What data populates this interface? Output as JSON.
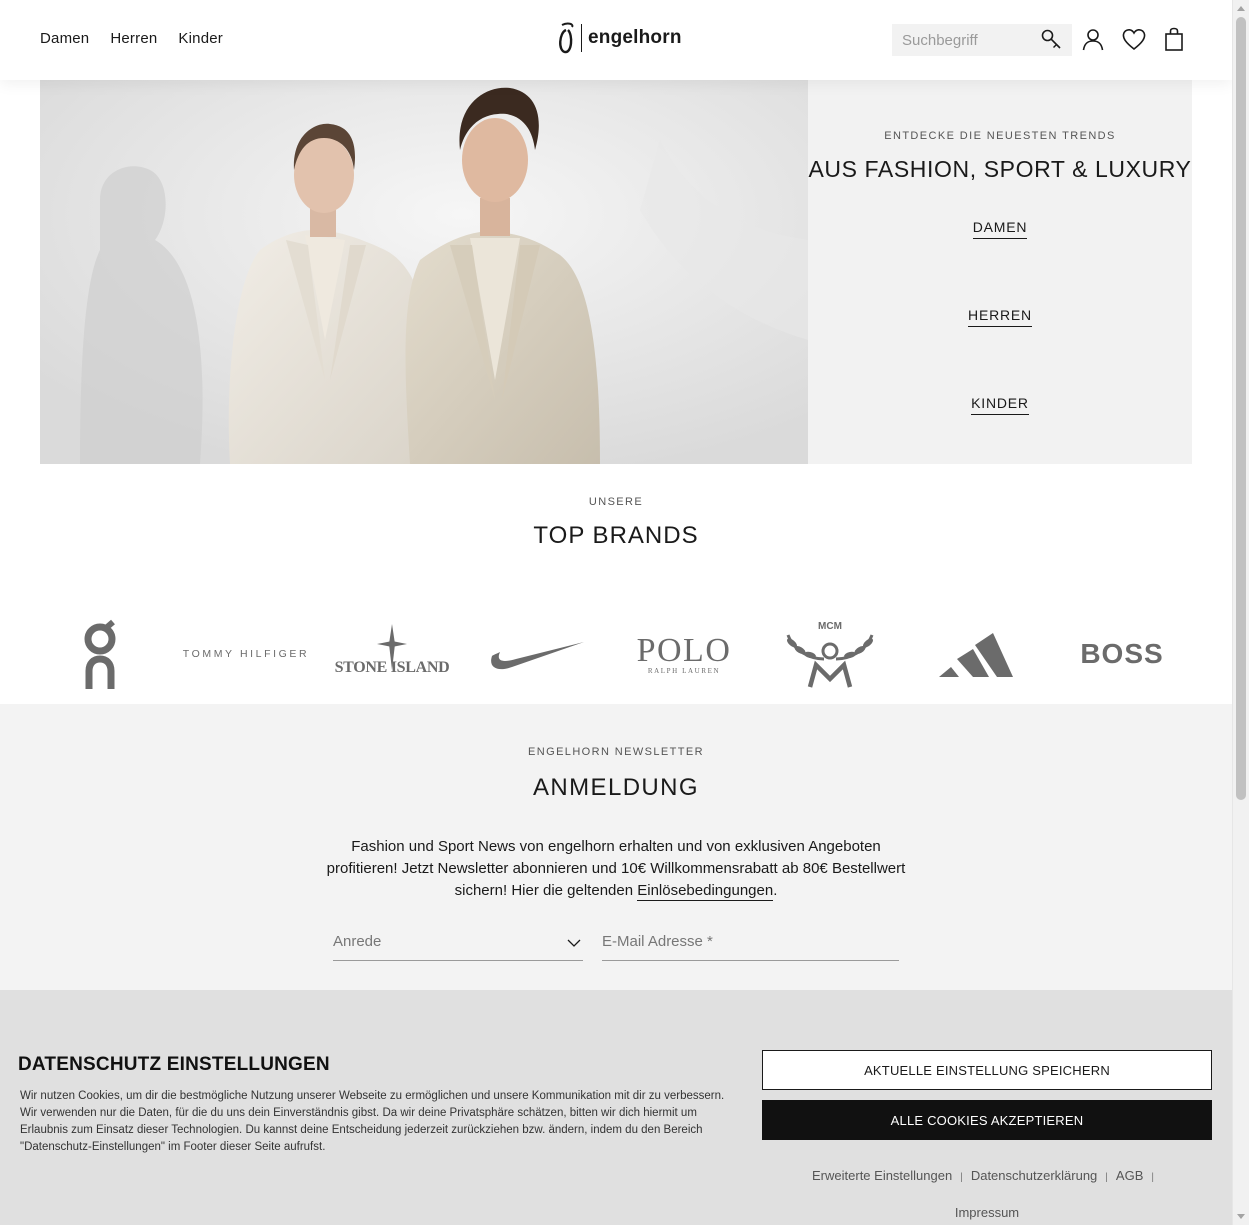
{
  "header": {
    "nav": [
      "Damen",
      "Herren",
      "Kinder"
    ],
    "logo_text": "engelhorn",
    "search_placeholder": "Suchbegriff"
  },
  "hero": {
    "eyebrow": "ENTDECKE DIE NEUESTEN TRENDS",
    "title": "AUS FASHION, SPORT & LUXURY",
    "links": [
      "DAMEN",
      "HERREN",
      "KINDER"
    ]
  },
  "top_brands": {
    "eyebrow": "UNSERE",
    "title": "TOP BRANDS",
    "brands": [
      {
        "name": "On",
        "logo_text": ""
      },
      {
        "name": "Tommy Hilfiger",
        "logo_text": "TOMMY HILFIGER"
      },
      {
        "name": "Stone Island",
        "logo_text": "STONE ISLAND"
      },
      {
        "name": "Nike",
        "logo_text": ""
      },
      {
        "name": "Polo Ralph Lauren",
        "logo_text": "POLO",
        "logo_subtext": "RALPH LAUREN"
      },
      {
        "name": "MCM",
        "logo_text": "MCM"
      },
      {
        "name": "adidas",
        "logo_text": ""
      },
      {
        "name": "BOSS",
        "logo_text": "BOSS"
      }
    ]
  },
  "newsletter": {
    "eyebrow": "ENGELHORN NEWSLETTER",
    "title": "ANMELDUNG",
    "text_before": "Fashion und Sport News von engelhorn erhalten und von exklusiven Angeboten profitieren! Jetzt Newsletter abonnieren und 10€ Willkommensrabatt ab 80€ Bestellwert sichern! Hier die geltenden ",
    "link": "Einlösebedingungen",
    "text_after": ".",
    "salutation_placeholder": "Anrede",
    "email_placeholder": "E-Mail Adresse *"
  },
  "cookie": {
    "title": "DATENSCHUTZ EINSTELLUNGEN",
    "text": "Wir nutzen Cookies, um dir die bestmögliche Nutzung unserer Webseite zu ermöglichen und unsere Kommunikation mit dir zu verbessern. Wir verwenden nur die Daten, für die du uns dein Einverständnis gibst. Da wir deine Privatsphäre schätzen, bitten wir dich hiermit um Erlaubnis zum Einsatz dieser Technologien. Du kannst deine Entscheidung jederzeit zurückziehen bzw. ändern, indem du den Bereich \"Datenschutz-Einstellungen\" im Footer dieser Seite aufrufst.",
    "save_button": "AKTUELLE EINSTELLUNG SPEICHERN",
    "accept_button": "ALLE COOKIES AKZEPTIEREN",
    "links": [
      "Erweiterte Einstellungen",
      "Datenschutzerklärung",
      "AGB",
      "Impressum"
    ],
    "separator": "|"
  },
  "colors": {
    "text": "#1a1a1a",
    "panel": "#f2f2f2",
    "cookie_bg": "#e0e0e0",
    "accept_bg": "#111111"
  }
}
